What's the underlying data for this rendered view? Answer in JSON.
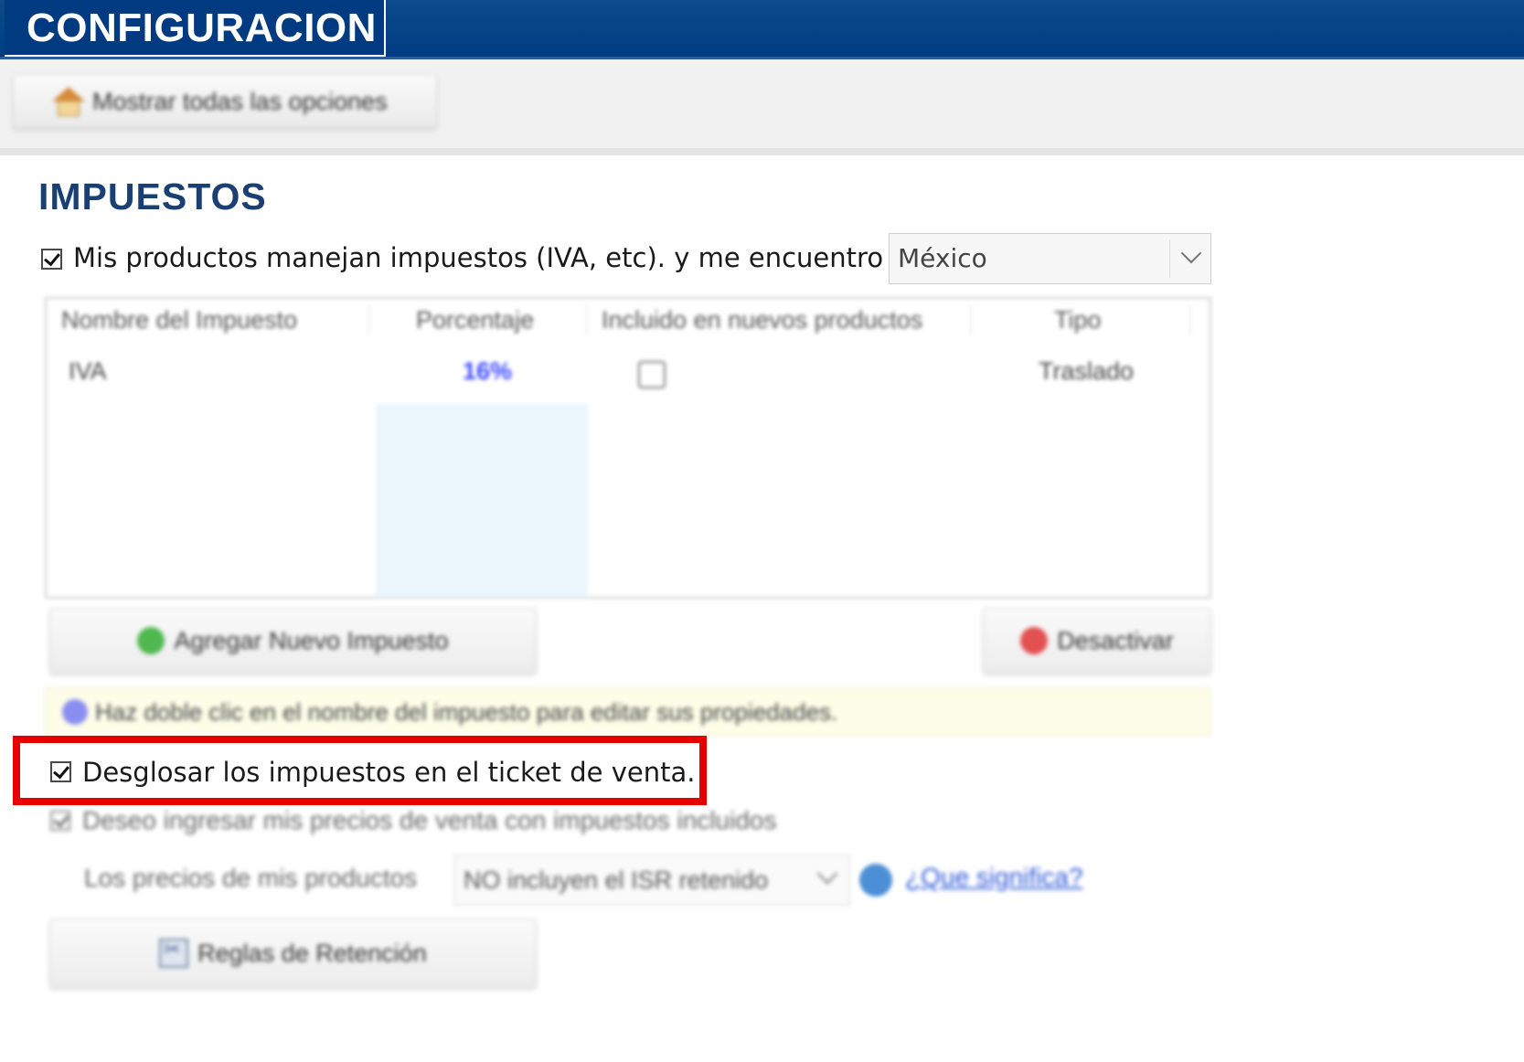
{
  "header": {
    "title": "CONFIGURACION"
  },
  "toolbar": {
    "show_all_label": "Mostrar todas las opciones",
    "show_all_icon": "home-icon"
  },
  "section": {
    "title": "IMPUESTOS"
  },
  "taxes_enabled": {
    "checked": true,
    "label": "Mis productos manejan impuestos (IVA, etc). y me encuentro en:",
    "country": "México"
  },
  "tax_table": {
    "columns": [
      "Nombre del Impuesto",
      "Porcentaje",
      "Incluido en nuevos productos",
      "Tipo"
    ],
    "rows": [
      {
        "name": "IVA",
        "percentage": "16%",
        "included": false,
        "type": "Traslado"
      }
    ]
  },
  "buttons": {
    "add_tax": "Agregar Nuevo Impuesto",
    "deactivate": "Desactivar",
    "retention_rules": "Reglas de Retención"
  },
  "info": {
    "text": "Haz doble clic en el nombre del impuesto para editar sus propiedades."
  },
  "options": {
    "breakdown_taxes": {
      "checked": true,
      "label": "Desglosar los impuestos en el ticket de venta."
    },
    "prices_include_taxes": {
      "checked": true,
      "label": "Deseo ingresar mis precios de venta con impuestos incluidos"
    },
    "isr": {
      "label": "Los precios de mis productos",
      "value": "NO incluyen el ISR retenido",
      "help_link": "¿Que significa?"
    }
  },
  "colors": {
    "header_bg": "#003c82",
    "section_title": "#1a3f73",
    "highlight_border": "#e60000",
    "percentage": "#3a46ff",
    "link": "#2f5ad6"
  }
}
